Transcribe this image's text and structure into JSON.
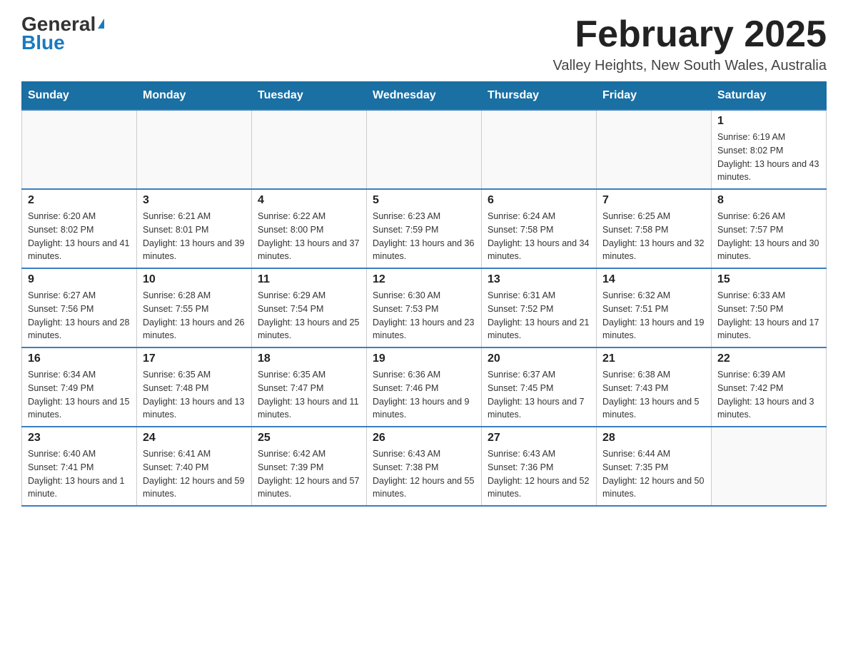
{
  "logo": {
    "line1": "General",
    "arrow": "▶",
    "line2": "Blue"
  },
  "title": {
    "month": "February 2025",
    "location": "Valley Heights, New South Wales, Australia"
  },
  "weekdays": [
    "Sunday",
    "Monday",
    "Tuesday",
    "Wednesday",
    "Thursday",
    "Friday",
    "Saturday"
  ],
  "weeks": [
    [
      {
        "day": "",
        "sunrise": "",
        "sunset": "",
        "daylight": ""
      },
      {
        "day": "",
        "sunrise": "",
        "sunset": "",
        "daylight": ""
      },
      {
        "day": "",
        "sunrise": "",
        "sunset": "",
        "daylight": ""
      },
      {
        "day": "",
        "sunrise": "",
        "sunset": "",
        "daylight": ""
      },
      {
        "day": "",
        "sunrise": "",
        "sunset": "",
        "daylight": ""
      },
      {
        "day": "",
        "sunrise": "",
        "sunset": "",
        "daylight": ""
      },
      {
        "day": "1",
        "sunrise": "Sunrise: 6:19 AM",
        "sunset": "Sunset: 8:02 PM",
        "daylight": "Daylight: 13 hours and 43 minutes."
      }
    ],
    [
      {
        "day": "2",
        "sunrise": "Sunrise: 6:20 AM",
        "sunset": "Sunset: 8:02 PM",
        "daylight": "Daylight: 13 hours and 41 minutes."
      },
      {
        "day": "3",
        "sunrise": "Sunrise: 6:21 AM",
        "sunset": "Sunset: 8:01 PM",
        "daylight": "Daylight: 13 hours and 39 minutes."
      },
      {
        "day": "4",
        "sunrise": "Sunrise: 6:22 AM",
        "sunset": "Sunset: 8:00 PM",
        "daylight": "Daylight: 13 hours and 37 minutes."
      },
      {
        "day": "5",
        "sunrise": "Sunrise: 6:23 AM",
        "sunset": "Sunset: 7:59 PM",
        "daylight": "Daylight: 13 hours and 36 minutes."
      },
      {
        "day": "6",
        "sunrise": "Sunrise: 6:24 AM",
        "sunset": "Sunset: 7:58 PM",
        "daylight": "Daylight: 13 hours and 34 minutes."
      },
      {
        "day": "7",
        "sunrise": "Sunrise: 6:25 AM",
        "sunset": "Sunset: 7:58 PM",
        "daylight": "Daylight: 13 hours and 32 minutes."
      },
      {
        "day": "8",
        "sunrise": "Sunrise: 6:26 AM",
        "sunset": "Sunset: 7:57 PM",
        "daylight": "Daylight: 13 hours and 30 minutes."
      }
    ],
    [
      {
        "day": "9",
        "sunrise": "Sunrise: 6:27 AM",
        "sunset": "Sunset: 7:56 PM",
        "daylight": "Daylight: 13 hours and 28 minutes."
      },
      {
        "day": "10",
        "sunrise": "Sunrise: 6:28 AM",
        "sunset": "Sunset: 7:55 PM",
        "daylight": "Daylight: 13 hours and 26 minutes."
      },
      {
        "day": "11",
        "sunrise": "Sunrise: 6:29 AM",
        "sunset": "Sunset: 7:54 PM",
        "daylight": "Daylight: 13 hours and 25 minutes."
      },
      {
        "day": "12",
        "sunrise": "Sunrise: 6:30 AM",
        "sunset": "Sunset: 7:53 PM",
        "daylight": "Daylight: 13 hours and 23 minutes."
      },
      {
        "day": "13",
        "sunrise": "Sunrise: 6:31 AM",
        "sunset": "Sunset: 7:52 PM",
        "daylight": "Daylight: 13 hours and 21 minutes."
      },
      {
        "day": "14",
        "sunrise": "Sunrise: 6:32 AM",
        "sunset": "Sunset: 7:51 PM",
        "daylight": "Daylight: 13 hours and 19 minutes."
      },
      {
        "day": "15",
        "sunrise": "Sunrise: 6:33 AM",
        "sunset": "Sunset: 7:50 PM",
        "daylight": "Daylight: 13 hours and 17 minutes."
      }
    ],
    [
      {
        "day": "16",
        "sunrise": "Sunrise: 6:34 AM",
        "sunset": "Sunset: 7:49 PM",
        "daylight": "Daylight: 13 hours and 15 minutes."
      },
      {
        "day": "17",
        "sunrise": "Sunrise: 6:35 AM",
        "sunset": "Sunset: 7:48 PM",
        "daylight": "Daylight: 13 hours and 13 minutes."
      },
      {
        "day": "18",
        "sunrise": "Sunrise: 6:35 AM",
        "sunset": "Sunset: 7:47 PM",
        "daylight": "Daylight: 13 hours and 11 minutes."
      },
      {
        "day": "19",
        "sunrise": "Sunrise: 6:36 AM",
        "sunset": "Sunset: 7:46 PM",
        "daylight": "Daylight: 13 hours and 9 minutes."
      },
      {
        "day": "20",
        "sunrise": "Sunrise: 6:37 AM",
        "sunset": "Sunset: 7:45 PM",
        "daylight": "Daylight: 13 hours and 7 minutes."
      },
      {
        "day": "21",
        "sunrise": "Sunrise: 6:38 AM",
        "sunset": "Sunset: 7:43 PM",
        "daylight": "Daylight: 13 hours and 5 minutes."
      },
      {
        "day": "22",
        "sunrise": "Sunrise: 6:39 AM",
        "sunset": "Sunset: 7:42 PM",
        "daylight": "Daylight: 13 hours and 3 minutes."
      }
    ],
    [
      {
        "day": "23",
        "sunrise": "Sunrise: 6:40 AM",
        "sunset": "Sunset: 7:41 PM",
        "daylight": "Daylight: 13 hours and 1 minute."
      },
      {
        "day": "24",
        "sunrise": "Sunrise: 6:41 AM",
        "sunset": "Sunset: 7:40 PM",
        "daylight": "Daylight: 12 hours and 59 minutes."
      },
      {
        "day": "25",
        "sunrise": "Sunrise: 6:42 AM",
        "sunset": "Sunset: 7:39 PM",
        "daylight": "Daylight: 12 hours and 57 minutes."
      },
      {
        "day": "26",
        "sunrise": "Sunrise: 6:43 AM",
        "sunset": "Sunset: 7:38 PM",
        "daylight": "Daylight: 12 hours and 55 minutes."
      },
      {
        "day": "27",
        "sunrise": "Sunrise: 6:43 AM",
        "sunset": "Sunset: 7:36 PM",
        "daylight": "Daylight: 12 hours and 52 minutes."
      },
      {
        "day": "28",
        "sunrise": "Sunrise: 6:44 AM",
        "sunset": "Sunset: 7:35 PM",
        "daylight": "Daylight: 12 hours and 50 minutes."
      },
      {
        "day": "",
        "sunrise": "",
        "sunset": "",
        "daylight": ""
      }
    ]
  ]
}
